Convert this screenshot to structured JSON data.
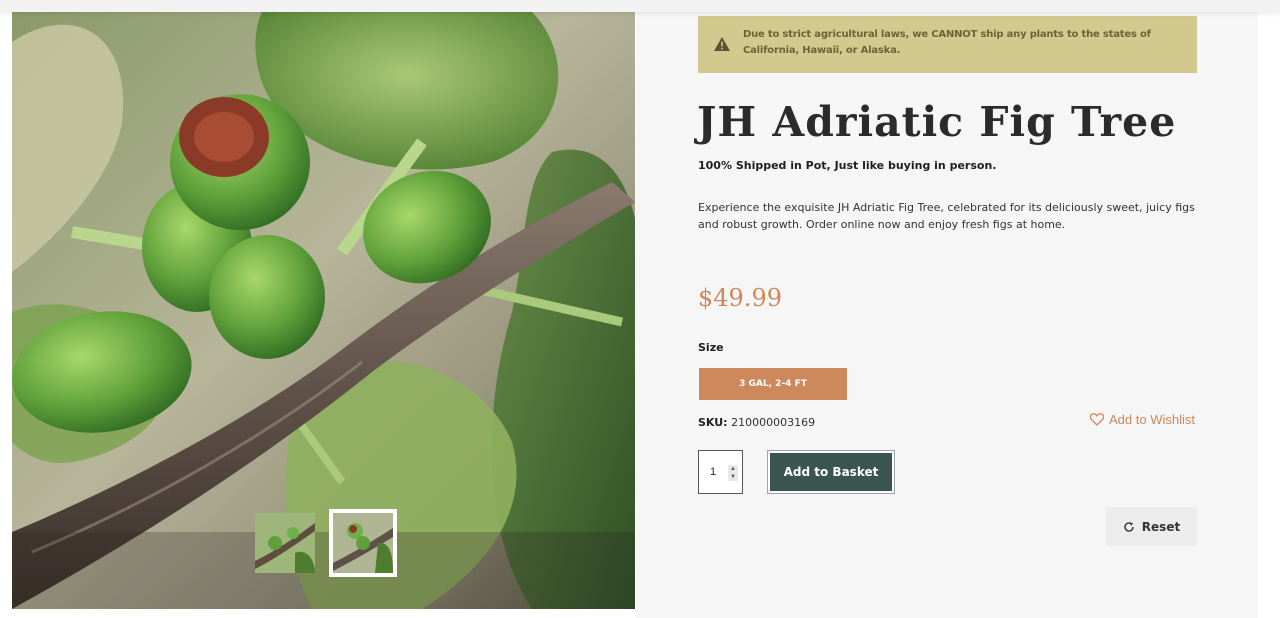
{
  "notice": {
    "text": "Due to strict agricultural laws, we CANNOT ship any plants to the states of California, Hawaii, or Alaska.",
    "icon": "warning-icon"
  },
  "product": {
    "title": "JH Adriatic Fig Tree",
    "subtitle": "100% Shipped in Pot, Just like buying in person.",
    "description": "Experience the exquisite JH Adriatic Fig Tree, celebrated for its deliciously sweet, juicy figs and robust growth. Order online now and enjoy fresh figs at home.",
    "price": "$49.99",
    "size_label": "Size",
    "size_option": "3 GAL, 2-4 FT",
    "sku_label": "SKU:",
    "sku_value": "210000003169",
    "wishlist_label": "Add to Wishlist",
    "quantity": "1",
    "add_to_basket": "Add to Basket",
    "reset": "Reset"
  },
  "gallery": {
    "thumbnails": [
      "fig-branch-thumbnail",
      "fig-closeup-thumbnail"
    ],
    "active_thumbnail": 2
  },
  "colors": {
    "accent": "#d0875a",
    "notice_bg": "#d3c98e",
    "button_dark": "#3a5550",
    "size_bg": "#cd895c"
  }
}
